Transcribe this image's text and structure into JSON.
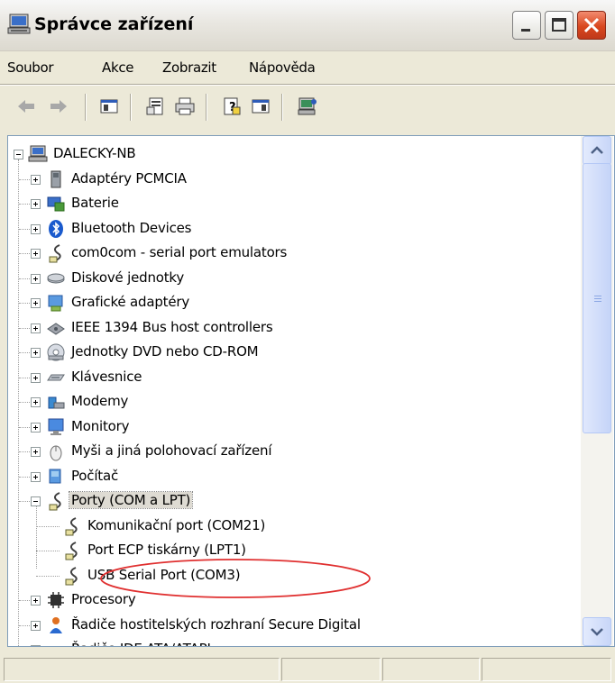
{
  "window": {
    "title": "Správce zařízení",
    "controls": {
      "minimize": "minimize",
      "maximize": "maximize",
      "close": "close"
    }
  },
  "menu": {
    "items": [
      "Soubor",
      "Akce",
      "Zobrazit",
      "Nápověda"
    ]
  },
  "toolbar": {
    "icons": [
      "back-arrow-icon",
      "forward-arrow-icon",
      "show-hide-console-tree-icon",
      "properties-icon",
      "print-icon",
      "help-icon",
      "show-action-pane-icon",
      "scan-hardware-icon"
    ]
  },
  "tree": {
    "root": {
      "label": "DALECKY-NB",
      "icon": "computer-icon",
      "expanded": true
    },
    "items": [
      {
        "label": "Adaptéry PCMCIA",
        "icon": "pcmcia-card-icon"
      },
      {
        "label": "Baterie",
        "icon": "battery-icon"
      },
      {
        "label": "Bluetooth Devices",
        "icon": "bluetooth-icon"
      },
      {
        "label": "com0com - serial port emulators",
        "icon": "serial-port-icon"
      },
      {
        "label": "Diskové jednotky",
        "icon": "disk-drive-icon"
      },
      {
        "label": "Grafické adaptéry",
        "icon": "display-adapter-icon"
      },
      {
        "label": "IEEE 1394 Bus host controllers",
        "icon": "ieee1394-icon"
      },
      {
        "label": "Jednotky DVD nebo CD-ROM",
        "icon": "cdrom-icon"
      },
      {
        "label": "Klávesnice",
        "icon": "keyboard-icon"
      },
      {
        "label": "Modemy",
        "icon": "modem-icon"
      },
      {
        "label": "Monitory",
        "icon": "monitor-icon"
      },
      {
        "label": "Myši a jiná polohovací zařízení",
        "icon": "mouse-icon"
      },
      {
        "label": "Počítač",
        "icon": "computer-small-icon"
      },
      {
        "label": "Porty (COM a LPT)",
        "icon": "port-icon",
        "expanded": true,
        "selected": true,
        "children": [
          {
            "label": "Komunikační port (COM21)",
            "icon": "port-icon"
          },
          {
            "label": "Port ECP tiskárny (LPT1)",
            "icon": "port-icon"
          },
          {
            "label": "USB Serial Port (COM3)",
            "icon": "port-icon",
            "highlighted": true
          }
        ]
      },
      {
        "label": "Procesory",
        "icon": "processor-icon"
      },
      {
        "label": "Řadiče hostitelských rozhraní Secure Digital",
        "icon": "sd-host-icon"
      },
      {
        "label": "Řadiče IDE ATA/ATAPI",
        "icon": "ide-controller-icon"
      }
    ]
  },
  "colors": {
    "window_bg": "#ECE9D8",
    "tree_bg": "#FFFFFF",
    "selection": "#DEDBD3",
    "annotation": "#E03030",
    "close_button": "#D9471E"
  }
}
